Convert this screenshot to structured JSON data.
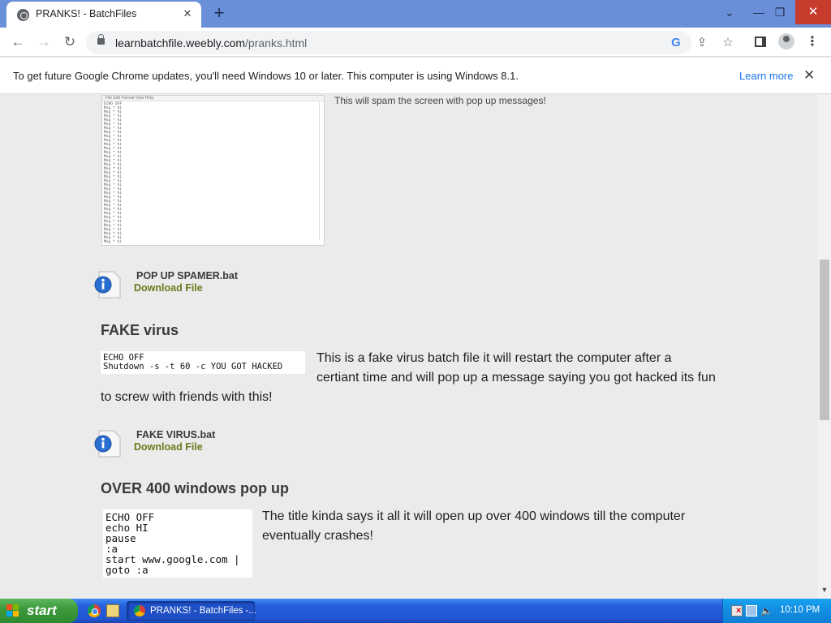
{
  "browser": {
    "tab_title": "PRANKS! - BatchFiles",
    "url_domain": "learnbatchfile.weebly.com",
    "url_path": "/pranks.html",
    "infobar_message": "To get future Google Chrome updates, you'll need Windows 10 or later. This computer is using Windows 8.1.",
    "infobar_link": "Learn more"
  },
  "page": {
    "notepad_caption": "This will spam the screen with pop up messages!",
    "notepad_menu": "File  Edit  Format  View  Help",
    "notepad_lines": "ECHO OFF\nMsg * hi\nMsg * hi\nMsg * hi\nMsg * hi\nMsg * hi\nMsg * hi\nMsg * hi\nMsg * hi\nMsg * hi\nMsg * hi\nMsg * hi\nMsg * hi\nMsg * hi\nMsg * hi\nMsg * hi\nMsg * hi\nMsg * hi\nMsg * hi\nMsg * hi\nMsg * hi\nMsg * hi\nMsg * hi\nMsg * hi\nMsg * hi\nMsg * hi\nMsg * hi\nMsg * hi\nMsg * hi\nMsg * hi\nMsg * hi\nMsg * hi\nMsg * hi\nMsg * hi\nMsg * hi",
    "download1": {
      "filename": "POP UP SPAMER.bat",
      "link": "Download File"
    },
    "section1": {
      "heading": "FAKE virus",
      "code": "ECHO OFF\nShutdown -s -t 60 -c YOU GOT HACKED",
      "text_line1": "This is a fake virus batch file it will restart the computer after a",
      "text_line2": "certiant time and will pop up a message saying you got hacked its fun",
      "text_line3": "to screw with friends with this!"
    },
    "download2": {
      "filename": "FAKE VIRUS.bat",
      "link": "Download File"
    },
    "section2": {
      "heading": "OVER 400 windows pop up",
      "code": "ECHO OFF\necho HI\npause\n:a\nstart www.google.com |\ngoto :a",
      "text_line1": "The title kinda says it all it will open up over 400 windows till the computer",
      "text_line2": "eventually crashes!"
    }
  },
  "taskbar": {
    "start_label": "start",
    "task_label": "PRANKS! - BatchFiles -...",
    "clock": "10:10 PM"
  },
  "colors": {
    "titlebar": "#6a8fd9",
    "download_link": "#6a7b1d",
    "link_blue": "#1a73e8",
    "taskbar_blue": "#245edb",
    "start_green": "#3c9a3c"
  }
}
